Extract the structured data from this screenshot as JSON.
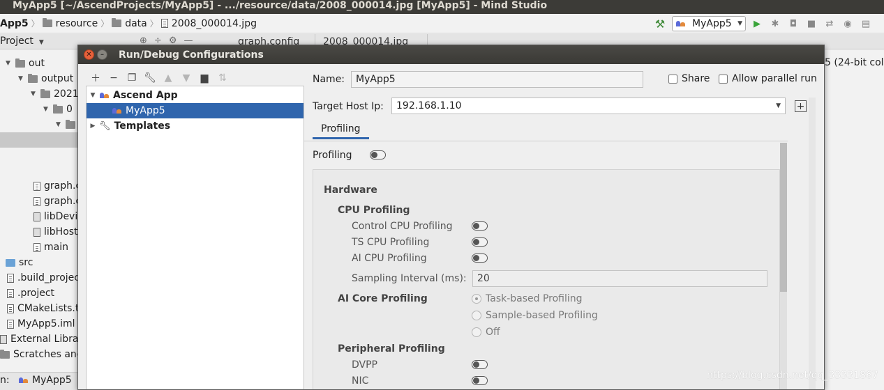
{
  "window": {
    "title": "MyApp5 [~/AscendProjects/MyApp5] - .../resource/data/2008_000014.jpg [MyApp5] - Mind Studio"
  },
  "breadcrumbs": [
    "App5",
    "resource",
    "data",
    "2008_000014.jpg"
  ],
  "run_toolbar": {
    "config_name": "MyApp5",
    "icons": [
      "hammer-icon",
      "run-icon",
      "debug-icon",
      "coverage-icon",
      "stop-icon",
      "build-icon",
      "view-icon",
      "layout-icon"
    ]
  },
  "project_panel": {
    "header": "Project",
    "tree": [
      {
        "label": "out",
        "level": 0,
        "expanded": true,
        "kind": "folder"
      },
      {
        "label": "output",
        "level": 1,
        "expanded": true,
        "kind": "folder"
      },
      {
        "label": "2021",
        "level": 2,
        "expanded": true,
        "kind": "folder"
      },
      {
        "label": "0",
        "level": 3,
        "expanded": true,
        "kind": "folder"
      },
      {
        "label": "",
        "level": 4,
        "expanded": true,
        "kind": "folder"
      },
      {
        "label": "graph.c",
        "level": 5,
        "kind": "file"
      },
      {
        "label": "graph.c",
        "level": 5,
        "kind": "file"
      },
      {
        "label": "libDevi",
        "level": 5,
        "kind": "lib"
      },
      {
        "label": "libHost",
        "level": 5,
        "kind": "lib"
      },
      {
        "label": "main",
        "level": 5,
        "kind": "file"
      },
      {
        "label": "src",
        "level": 0,
        "kind": "src"
      },
      {
        "label": ".build_projec",
        "level": 0,
        "kind": "file"
      },
      {
        "label": ".project",
        "level": 0,
        "kind": "file"
      },
      {
        "label": "CMakeLists.t",
        "level": 0,
        "kind": "file"
      },
      {
        "label": "MyApp5.iml",
        "level": 0,
        "kind": "file"
      },
      {
        "label": "External Librar",
        "level": -1,
        "kind": "lib"
      },
      {
        "label": "Scratches and C",
        "level": -1,
        "kind": "folder"
      }
    ]
  },
  "editor_tabs": [
    "graph.config",
    "2008_000014.jpg"
  ],
  "bottom": {
    "prefix": "n:",
    "run_label": "MyApp5"
  },
  "right_snippet": "5 (24-bit colo",
  "dialog": {
    "title": "Run/Debug Configurations",
    "toolbar": [
      "add-icon",
      "remove-icon",
      "copy-icon",
      "wrench-icon",
      "move-up-icon",
      "move-down-icon",
      "new-folder-icon",
      "sort-icon"
    ],
    "tree": {
      "group": "Ascend App",
      "item": "MyApp5",
      "templates": "Templates"
    },
    "name_label": "Name:",
    "name_value": "MyApp5",
    "share_label": "Share",
    "parallel_label": "Allow parallel run",
    "host_label": "Target Host Ip:",
    "host_value": "192.168.1.10",
    "tab": "Profiling",
    "profiling_label": "Profiling",
    "hardware": "Hardware",
    "cpu_section": "CPU Profiling",
    "cpu_items": [
      "Control CPU Profiling",
      "TS CPU Profiling",
      "AI CPU Profiling"
    ],
    "sampling_label": "Sampling Interval (ms):",
    "sampling_value": "20",
    "aicore_section": "AI Core Profiling",
    "aicore_options": [
      "Task-based Profiling",
      "Sample-based Profiling",
      "Off"
    ],
    "aicore_selected": "Task-based Profiling",
    "peripheral_section": "Peripheral Profiling",
    "peripheral_items": [
      "DVPP",
      "NIC"
    ]
  },
  "watermark": "https://blog.csdn.net/qq_33331867"
}
